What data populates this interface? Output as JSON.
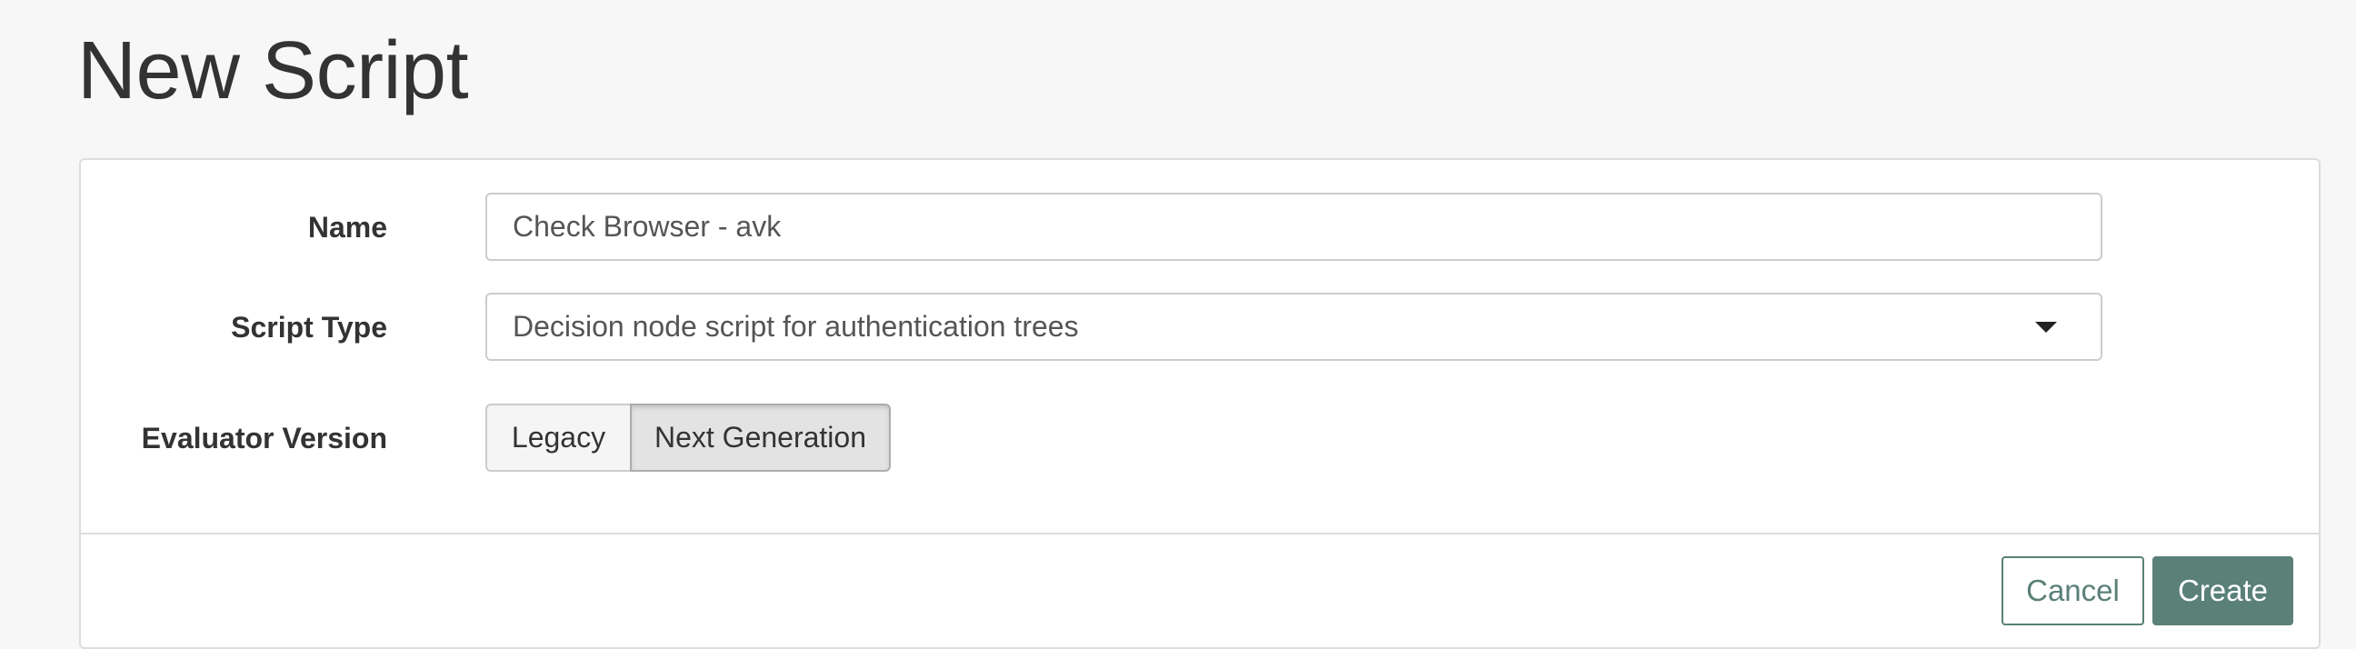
{
  "page": {
    "title": "New Script"
  },
  "form": {
    "name": {
      "label": "Name",
      "value": "Check Browser - avk"
    },
    "script_type": {
      "label": "Script Type",
      "selected": "Decision node script for authentication trees"
    },
    "evaluator_version": {
      "label": "Evaluator Version",
      "options": [
        "Legacy",
        "Next Generation"
      ],
      "selected": "Next Generation"
    }
  },
  "actions": {
    "cancel_label": "Cancel",
    "create_label": "Create"
  },
  "colors": {
    "accent": "#5a8078",
    "page_bg": "#f7f7f7"
  },
  "icons": {
    "select_caret": "caret-down-icon"
  }
}
